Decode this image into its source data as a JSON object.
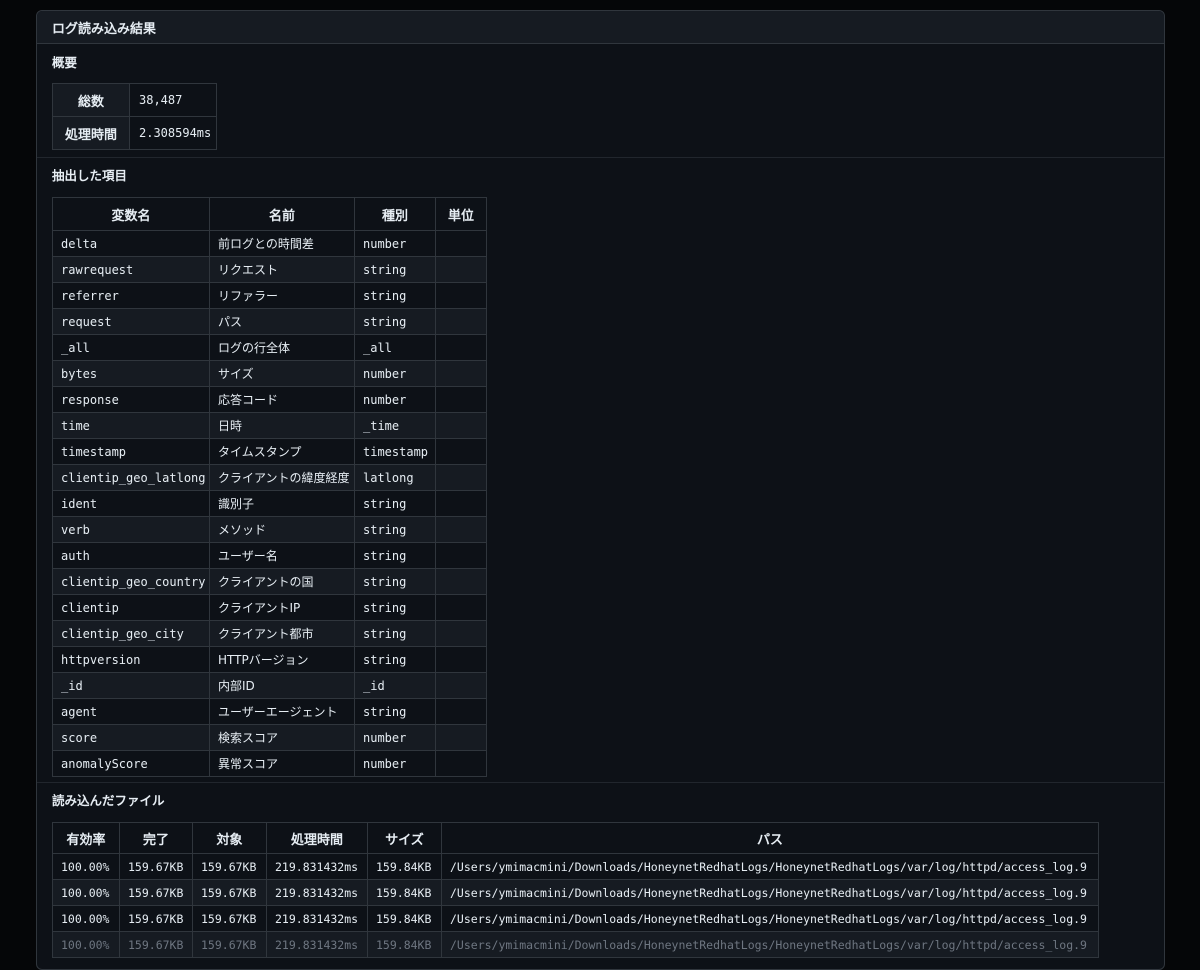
{
  "panel": {
    "title": "ログ読み込み結果"
  },
  "summary": {
    "title": "概要",
    "rows": [
      {
        "label": "総数",
        "value": "38,487"
      },
      {
        "label": "処理時間",
        "value": "2.308594ms"
      }
    ]
  },
  "fields": {
    "title": "抽出した項目",
    "columns": [
      "変数名",
      "名前",
      "種別",
      "単位"
    ],
    "rows": [
      [
        "delta",
        "前ログとの時間差",
        "number",
        ""
      ],
      [
        "rawrequest",
        "リクエスト",
        "string",
        ""
      ],
      [
        "referrer",
        "リファラー",
        "string",
        ""
      ],
      [
        "request",
        "パス",
        "string",
        ""
      ],
      [
        "_all",
        "ログの行全体",
        "_all",
        ""
      ],
      [
        "bytes",
        "サイズ",
        "number",
        ""
      ],
      [
        "response",
        "応答コード",
        "number",
        ""
      ],
      [
        "time",
        "日時",
        "_time",
        ""
      ],
      [
        "timestamp",
        "タイムスタンプ",
        "timestamp",
        ""
      ],
      [
        "clientip_geo_latlong",
        "クライアントの緯度経度",
        "latlong",
        ""
      ],
      [
        "ident",
        "識別子",
        "string",
        ""
      ],
      [
        "verb",
        "メソッド",
        "string",
        ""
      ],
      [
        "auth",
        "ユーザー名",
        "string",
        ""
      ],
      [
        "clientip_geo_country",
        "クライアントの国",
        "string",
        ""
      ],
      [
        "clientip",
        "クライアントIP",
        "string",
        ""
      ],
      [
        "clientip_geo_city",
        "クライアント都市",
        "string",
        ""
      ],
      [
        "httpversion",
        "HTTPバージョン",
        "string",
        ""
      ],
      [
        "_id",
        "内部ID",
        "_id",
        ""
      ],
      [
        "agent",
        "ユーザーエージェント",
        "string",
        ""
      ],
      [
        "score",
        "検索スコア",
        "number",
        ""
      ],
      [
        "anomalyScore",
        "異常スコア",
        "number",
        ""
      ]
    ]
  },
  "files": {
    "title": "読み込んだファイル",
    "columns": [
      "有効率",
      "完了",
      "対象",
      "処理時間",
      "サイズ",
      "パス"
    ],
    "rows": [
      [
        "100.00%",
        "159.67KB",
        "159.67KB",
        "219.831432ms",
        "159.84KB",
        "/Users/ymimacmini/Downloads/HoneynetRedhatLogs/HoneynetRedhatLogs/var/log/httpd/access_log.9"
      ],
      [
        "100.00%",
        "159.67KB",
        "159.67KB",
        "219.831432ms",
        "159.84KB",
        "/Users/ymimacmini/Downloads/HoneynetRedhatLogs/HoneynetRedhatLogs/var/log/httpd/access_log.9"
      ],
      [
        "100.00%",
        "159.67KB",
        "159.67KB",
        "219.831432ms",
        "159.84KB",
        "/Users/ymimacmini/Downloads/HoneynetRedhatLogs/HoneynetRedhatLogs/var/log/httpd/access_log.9"
      ],
      [
        "100.00%",
        "159.67KB",
        "159.67KB",
        "219.831432ms",
        "159.84KB",
        "/Users/ymimacmini/Downloads/HoneynetRedhatLogs/HoneynetRedhatLogs/var/log/httpd/access_log.9"
      ]
    ]
  }
}
